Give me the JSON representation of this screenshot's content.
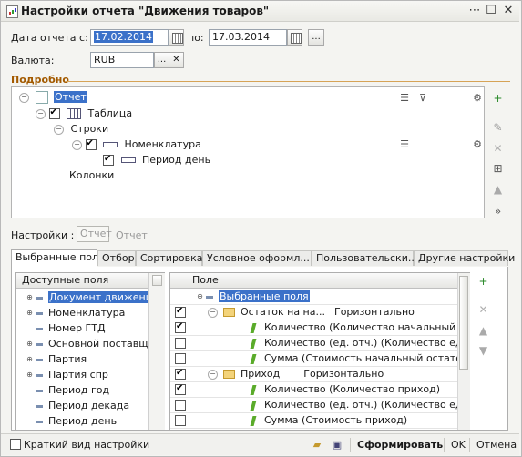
{
  "window": {
    "title": "Настройки отчета \"Движения товаров\""
  },
  "period": {
    "date_from_label": "Дата отчета с:",
    "date_from_value": "17.02.2014",
    "date_to_label": "по:",
    "date_to_value": "17.03.2014",
    "more_button": "..."
  },
  "currency": {
    "label": "Валюта:",
    "value": "RUB",
    "select_button": "...",
    "clear_button": "✕"
  },
  "details": {
    "section_title": "Подробно",
    "tree": [
      {
        "label": "Отчет",
        "selected": true
      },
      {
        "label": "Таблица",
        "checked": true
      },
      {
        "label": "Строки"
      },
      {
        "label": "Номенклатура",
        "checked": true
      },
      {
        "label": "Период день",
        "checked": true
      },
      {
        "label": "Колонки"
      }
    ]
  },
  "settings_row": {
    "label": "Настройки :",
    "value": "Отчет",
    "text": "Отчет"
  },
  "tabs": [
    "Выбранные поля",
    "Отбор",
    "Сортировка",
    "Условное оформл...",
    "Пользовательски...",
    "Другие настройки"
  ],
  "available_fields": {
    "header": "Доступные поля",
    "items": [
      "Документ движения",
      "Номенклатура",
      "Номер ГТД",
      "Основной поставщ",
      "Партия",
      "Партия спр",
      "Период год",
      "Период декада",
      "Период день"
    ]
  },
  "selected_fields": {
    "header": "Поле",
    "rows": [
      {
        "label": "Выбранные поля",
        "kind": "root"
      },
      {
        "label": "Остаток на на...",
        "extra": "Горизонтально",
        "kind": "group",
        "checked": true
      },
      {
        "label": "Количество (Количество начальный ос...",
        "kind": "field",
        "checked": true
      },
      {
        "label": "Количество (ед. отч.) (Количество ед от...",
        "kind": "field",
        "checked": false
      },
      {
        "label": "Сумма (Стоимость начальный остаток)",
        "kind": "field",
        "checked": false
      },
      {
        "label": "Приход",
        "extra": "Горизонтально",
        "kind": "group",
        "checked": true
      },
      {
        "label": "Количество (Количество приход)",
        "kind": "field",
        "checked": true
      },
      {
        "label": "Количество (ед. отч.) (Количество ед от...",
        "kind": "field",
        "checked": false
      },
      {
        "label": "Сумма (Стоимость приход)",
        "kind": "field",
        "checked": false
      }
    ]
  },
  "footer": {
    "short_view_label": "Краткий вид настройки",
    "generate_button": "Сформировать",
    "ok_button": "OK",
    "cancel_button": "Отмена"
  },
  "colors": {
    "selection": "#3b71c9",
    "section_title": "#a35a00",
    "accent_green": "#5aab2a"
  }
}
